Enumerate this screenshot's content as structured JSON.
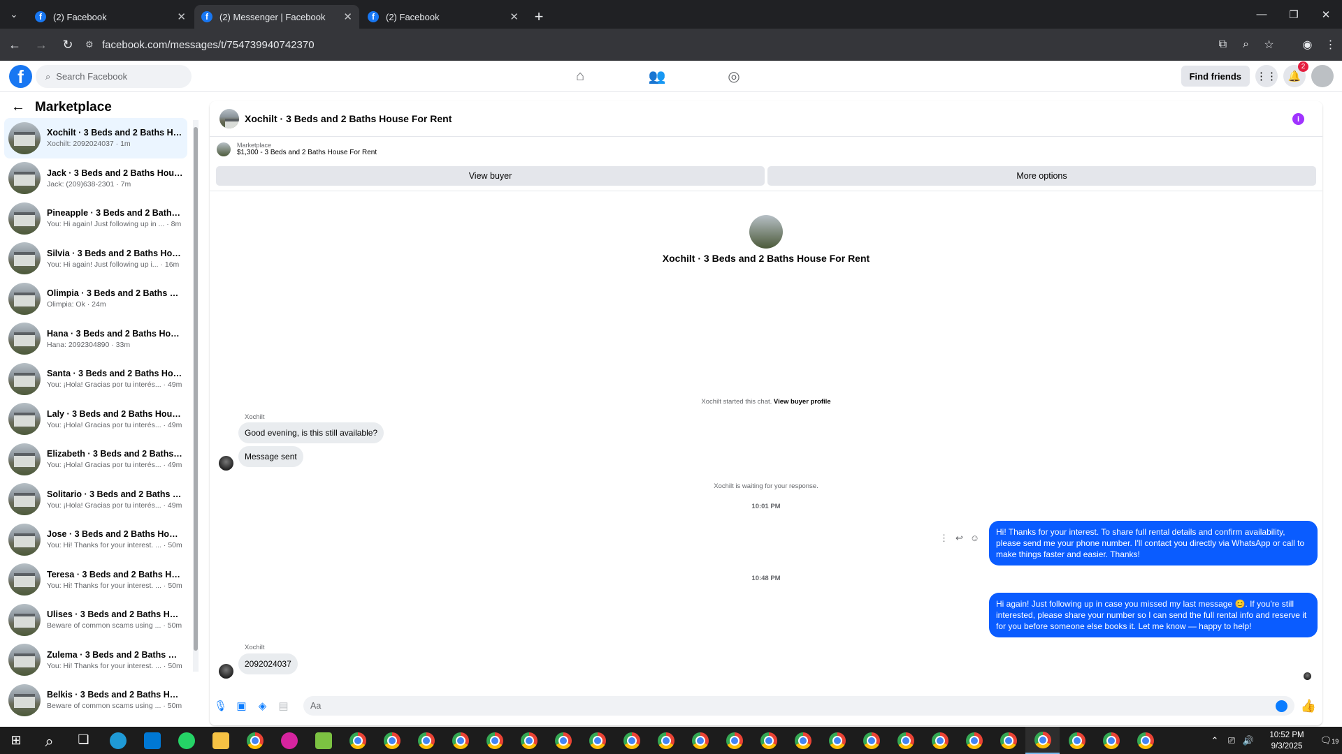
{
  "browser": {
    "tabs": [
      {
        "title": "(2) Facebook",
        "active": false
      },
      {
        "title": "(2) Messenger | Facebook",
        "active": true
      },
      {
        "title": "(2) Facebook",
        "active": false
      }
    ],
    "url": "facebook.com/messages/t/754739940742370"
  },
  "fb": {
    "search_placeholder": "Search Facebook",
    "find_friends": "Find friends",
    "notifications_count": "2"
  },
  "sidebar": {
    "title": "Marketplace",
    "conversations": [
      {
        "name": "Xochilt · 3 Beds and 2 Baths Ho...",
        "preview": "Xochilt: 2092024037 · 1m",
        "active": true
      },
      {
        "name": "Jack · 3 Beds and 2 Baths House...",
        "preview": "Jack: (209)638-2301 · 7m",
        "active": false
      },
      {
        "name": "Pineapple · 3 Beds and 2 Baths ...",
        "preview": "You: Hi again! Just following up in ... · 8m",
        "active": false
      },
      {
        "name": "Silvia · 3 Beds and 2 Baths Hous...",
        "preview": "You: Hi again! Just following up i... · 16m",
        "active": false
      },
      {
        "name": "Olimpia · 3 Beds and 2 Baths H...",
        "preview": "Olimpia: Ok · 24m",
        "active": false
      },
      {
        "name": "Hana · 3 Beds and 2 Baths Hous...",
        "preview": "Hana: 2092304890 · 33m",
        "active": false
      },
      {
        "name": "Santa · 3 Beds and 2 Baths Hou...",
        "preview": "You: ¡Hola! Gracias por tu interés... · 49m",
        "active": false
      },
      {
        "name": "Laly · 3 Beds and 2 Baths House...",
        "preview": "You: ¡Hola! Gracias por tu interés... · 49m",
        "active": false
      },
      {
        "name": "Elizabeth · 3 Beds and 2 Baths ...",
        "preview": "You: ¡Hola! Gracias por tu interés... · 49m",
        "active": false
      },
      {
        "name": "Solitario · 3 Beds and 2 Baths H...",
        "preview": "You: ¡Hola! Gracias por tu interés... · 49m",
        "active": false
      },
      {
        "name": "Jose · 3 Beds and 2 Baths Hous...",
        "preview": "You: Hi! Thanks for your interest. ... · 50m",
        "active": false
      },
      {
        "name": "Teresa · 3 Beds and 2 Baths Hou...",
        "preview": "You: Hi! Thanks for your interest. ... · 50m",
        "active": false
      },
      {
        "name": "Ulises · 3 Beds and 2 Baths Hou...",
        "preview": "Beware of common scams using ... · 50m",
        "active": false
      },
      {
        "name": "Zulema · 3 Beds and 2 Baths Ho...",
        "preview": "You: Hi! Thanks for your interest. ... · 50m",
        "active": false
      },
      {
        "name": "Belkis · 3 Beds and 2 Baths Hou...",
        "preview": "Beware of common scams using ... · 50m",
        "active": false
      }
    ]
  },
  "chat": {
    "title": "Xochilt · 3 Beds and 2 Baths House For Rent",
    "listing_label": "Marketplace",
    "listing_title": "$1,300 - 3 Beds and 2 Baths House For Rent",
    "view_buyer": "View buyer",
    "more_options": "More options",
    "hero_name": "Xochilt · 3 Beds and 2 Baths House For Rent",
    "started_text": "Xochilt started this chat.",
    "view_buyer_profile": "View buyer profile",
    "sender_name": "Xochilt",
    "msg_in_1": "Good evening, is this still available?",
    "msg_in_2": "Message sent",
    "waiting_text": "Xochilt is waiting for your response.",
    "time_1": "10:01 PM",
    "msg_out_1": "Hi! Thanks for your interest. To share full rental details and confirm availability, please send me your phone number. I'll contact you directly via WhatsApp or call to make things faster and easier. Thanks!",
    "time_2": "10:48 PM",
    "msg_out_2": "Hi again! Just following up in case you missed my last message 😊. If you're still interested, please share your number so I can send the full rental info and reserve it for you before someone else books it. Let me know — happy to help!",
    "sender_name_2": "Xochilt",
    "msg_in_3": "2092024037",
    "composer_placeholder": "Aa"
  },
  "taskbar": {
    "time": "10:52 PM",
    "date": "9/3/2025",
    "notifications": "19"
  }
}
